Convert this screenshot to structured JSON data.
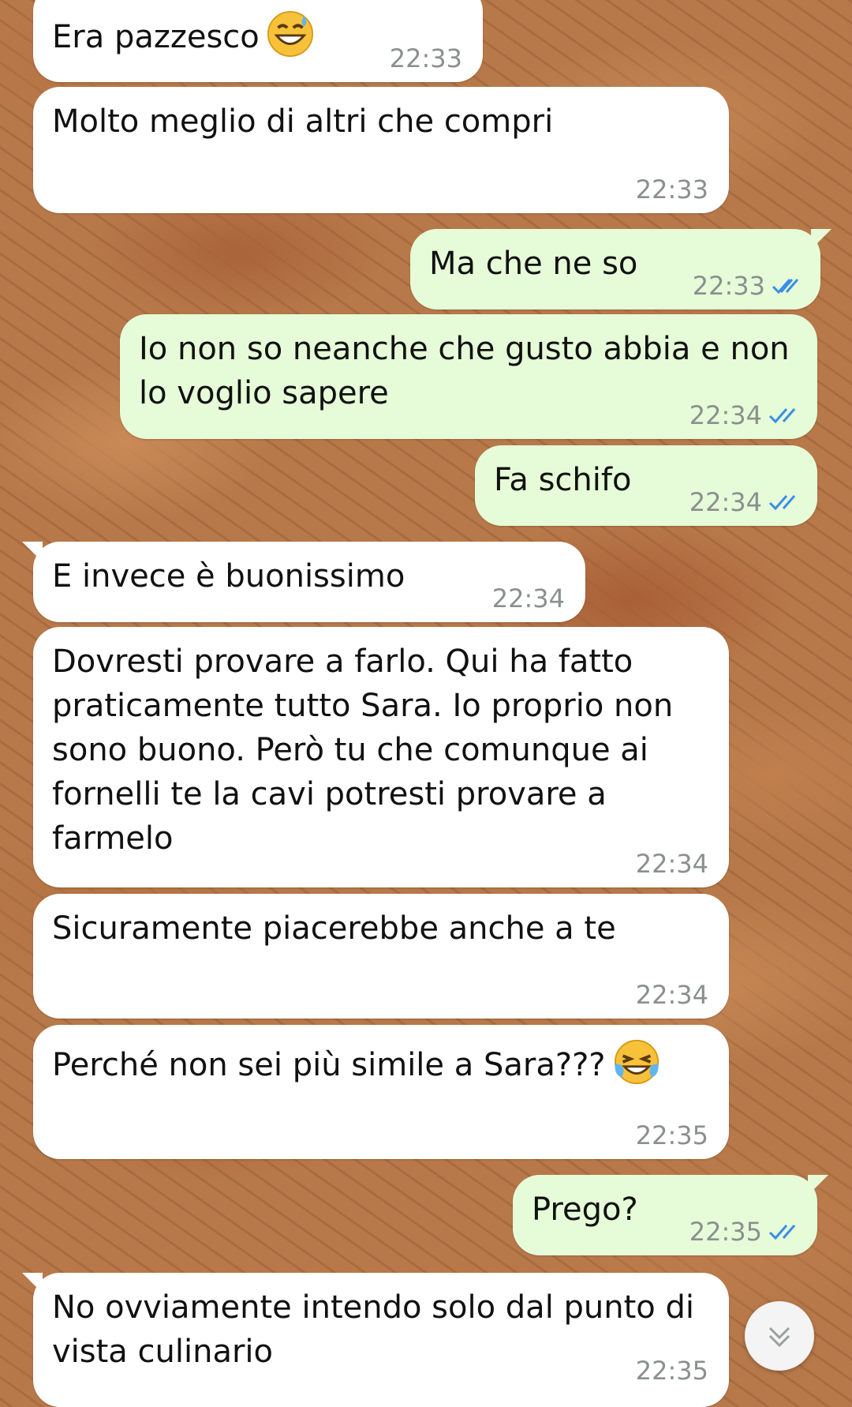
{
  "messages": [
    {
      "text": "Era pazzesco",
      "time": "22:33",
      "direction": "incoming",
      "emoji": "grinning-sweat"
    },
    {
      "text": "Molto meglio di altri che compri",
      "time": "22:33",
      "direction": "incoming"
    },
    {
      "text": "Ma che ne so",
      "time": "22:33",
      "direction": "outgoing",
      "status": "read"
    },
    {
      "text": "Io non so neanche che gusto abbia e non lo voglio sapere",
      "time": "22:34",
      "direction": "outgoing",
      "status": "read"
    },
    {
      "text": "Fa schifo",
      "time": "22:34",
      "direction": "outgoing",
      "status": "read"
    },
    {
      "text": "E invece è buonissimo",
      "time": "22:34",
      "direction": "incoming"
    },
    {
      "text": "Dovresti provare a farlo. Qui ha fatto praticamente tutto Sara. Io proprio non sono buono. Però tu che comunque ai fornelli te la cavi potresti provare a farmelo",
      "time": "22:34",
      "direction": "incoming"
    },
    {
      "text": "Sicuramente piacerebbe anche a te",
      "time": "22:34",
      "direction": "incoming"
    },
    {
      "text": "Perché non sei più simile a Sara???",
      "time": "22:35",
      "direction": "incoming",
      "emoji": "tears-of-joy"
    },
    {
      "text": "Prego?",
      "time": "22:35",
      "direction": "outgoing",
      "status": "read"
    },
    {
      "text": "No ovviamente intendo solo dal punto di vista culinario",
      "time": "22:35",
      "direction": "incoming"
    }
  ],
  "icons": {
    "read_ticks": "double-check-icon",
    "scroll_down": "double-chevron-down-icon"
  },
  "colors": {
    "incoming_bubble": "#ffffff",
    "outgoing_bubble": "#e6fcd8",
    "read_ticks": "#3a8ee6",
    "timestamp": "#8a8f8f",
    "wallpaper": "#b8794a"
  }
}
